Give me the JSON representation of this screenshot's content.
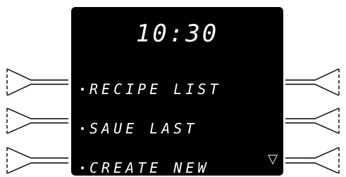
{
  "display": {
    "time": "10:30",
    "menu": [
      {
        "label": "RECIPE LIST"
      },
      {
        "label": "SAUE LAST"
      },
      {
        "label": "CREATE NEW"
      }
    ],
    "more_indicator": "▽"
  },
  "colors": {
    "screen_bg": "#000000",
    "text": "#ffffff",
    "line": "#000000"
  }
}
